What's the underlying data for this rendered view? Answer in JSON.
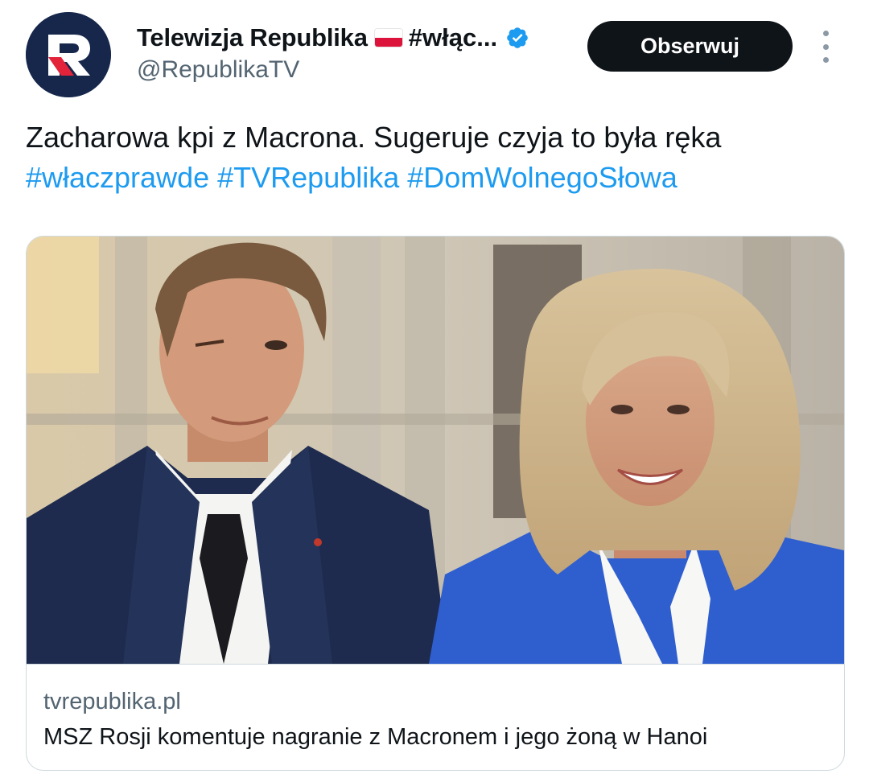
{
  "author": {
    "display_name": "Telewizja Republika",
    "display_name_tail": "#włąc...",
    "handle": "@RepublikaTV",
    "avatar_letter": "R",
    "flag": "poland-flag-icon",
    "verified_icon": "verified-badge-icon",
    "verified_color": "#1d9bf0"
  },
  "actions": {
    "follow_label": "Obserwuj",
    "more_icon": "more-vertical-icon"
  },
  "tweet": {
    "text": "Zacharowa kpi z Macrona. Sugeruje czyja to była ręka",
    "hashtags": [
      "#właczprawde",
      "#TVRepublika",
      "#DomWolnegoSłowa"
    ]
  },
  "link_card": {
    "domain": "tvrepublika.pl",
    "title": "MSZ Rosji komentuje nagranie z Macronem i jego żoną w Hanoi"
  },
  "colors": {
    "text": "#0f1419",
    "secondary_text": "#536471",
    "link": "#1d9bf0",
    "button_bg": "#0f1419"
  }
}
